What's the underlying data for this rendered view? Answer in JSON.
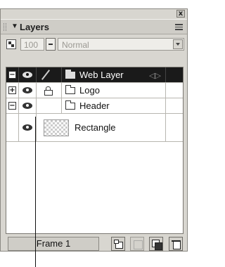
{
  "panel": {
    "title": "Layers",
    "close_glyph": "x"
  },
  "toolbar": {
    "opacity_value": "100",
    "blend_mode": "Normal"
  },
  "layers": [
    {
      "name": "Web Layer",
      "toggle": "⊟",
      "selected": true,
      "icon": "folder-icon",
      "extra_glyph": "◁▷"
    },
    {
      "name": "Logo",
      "toggle": "⊞",
      "selected": false,
      "icon": "folder-icon",
      "locked": true
    },
    {
      "name": "Header",
      "toggle": "⊟",
      "selected": false,
      "icon": "folder-icon"
    },
    {
      "name": "Rectangle",
      "type": "object",
      "icon": "checkerboard-thumbnail"
    }
  ],
  "footer": {
    "frame_label": "Frame 1"
  },
  "colors": {
    "panel_bg": "#d8d6d0",
    "selected_row": "#1a1a1a",
    "list_bg": "#ffffff"
  }
}
